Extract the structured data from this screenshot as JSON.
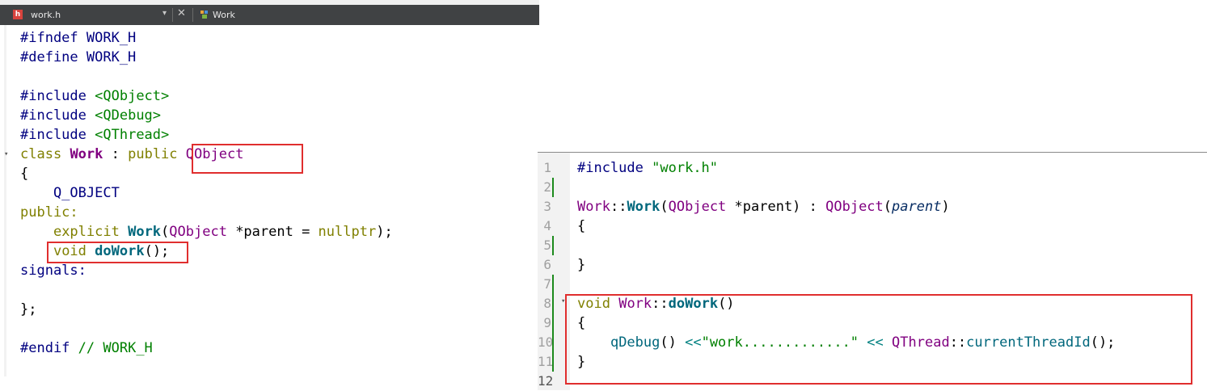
{
  "left_tab": {
    "file_name": "work.h",
    "file_icon": "h",
    "dropdown": "▾",
    "close": "✕",
    "class_name": "Work"
  },
  "left_code": [
    "#ifndef WORK_H",
    "#define WORK_H",
    "",
    "#include <QObject>",
    "#include <QDebug>",
    "#include <QThread>",
    "class Work : public QObject",
    "{",
    "    Q_OBJECT",
    "public:",
    "    explicit Work(QObject *parent = nullptr);",
    "    void doWork();",
    "signals:",
    "",
    "};",
    "",
    "#endif // WORK_H"
  ],
  "right_line_numbers": [
    "1",
    "2",
    "3",
    "4",
    "5",
    "6",
    "7",
    "8",
    "9",
    "10",
    "11",
    "12"
  ],
  "right_code": [
    "#include \"work.h\"",
    "",
    "Work::Work(QObject *parent) : QObject(parent)",
    "{",
    "",
    "}",
    "",
    "void Work::doWork()",
    "{",
    "    qDebug() <<\"work.............\" << QThread::currentThreadId();",
    "}",
    ""
  ],
  "colors": {
    "highlight_box": "#e02e2e",
    "keyword": "#808000",
    "type": "#800080",
    "function": "#00677c",
    "preprocessor": "#000080",
    "string": "#008000"
  }
}
